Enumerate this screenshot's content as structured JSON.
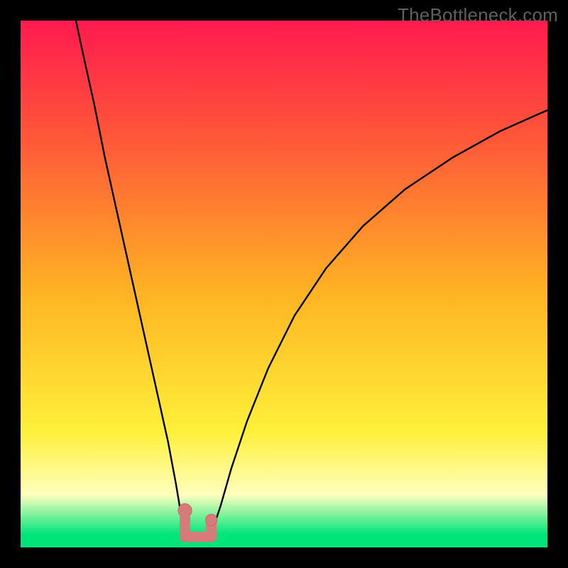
{
  "watermark": "TheBottleneck.com",
  "colors": {
    "frame": "#000000",
    "gradient_top": "#ff1a4f",
    "gradient_upper": "#ff5639",
    "gradient_mid": "#ffb423",
    "gradient_lower": "#fff03a",
    "gradient_pale": "#ffffbe",
    "gradient_bottom": "#00e57a",
    "curve": "#000000",
    "marker_fill": "#d77a7a",
    "marker_stroke": "#c96868"
  },
  "chart_data": {
    "type": "line",
    "title": "",
    "xlabel": "",
    "ylabel": "",
    "x_range": [
      0,
      100
    ],
    "y_range": [
      0,
      100
    ],
    "curve": {
      "name": "bottleneck-curve",
      "min_x": 32.5,
      "points": [
        {
          "x": 10.5,
          "y": 100
        },
        {
          "x": 12,
          "y": 93
        },
        {
          "x": 14,
          "y": 84
        },
        {
          "x": 16,
          "y": 74
        },
        {
          "x": 18,
          "y": 65
        },
        {
          "x": 20,
          "y": 56
        },
        {
          "x": 22,
          "y": 47
        },
        {
          "x": 24,
          "y": 38
        },
        {
          "x": 26,
          "y": 29
        },
        {
          "x": 28,
          "y": 20
        },
        {
          "x": 29.5,
          "y": 12
        },
        {
          "x": 30.5,
          "y": 6
        },
        {
          "x": 31.5,
          "y": 2.2
        },
        {
          "x": 32.5,
          "y": 1.6
        },
        {
          "x": 33.5,
          "y": 1.6
        },
        {
          "x": 35,
          "y": 1.8
        },
        {
          "x": 36.5,
          "y": 3.5
        },
        {
          "x": 38,
          "y": 8
        },
        {
          "x": 40,
          "y": 15
        },
        {
          "x": 43,
          "y": 24
        },
        {
          "x": 47,
          "y": 34
        },
        {
          "x": 52,
          "y": 44
        },
        {
          "x": 58,
          "y": 53
        },
        {
          "x": 65,
          "y": 61
        },
        {
          "x": 73,
          "y": 68
        },
        {
          "x": 82,
          "y": 74
        },
        {
          "x": 91,
          "y": 79
        },
        {
          "x": 100,
          "y": 83
        }
      ]
    },
    "marker": {
      "name": "optimal-region",
      "segments": [
        {
          "type": "dot",
          "x": 31.2,
          "y": 7.0,
          "r": 1.3
        },
        {
          "type": "bar",
          "x": 31.2,
          "y0": 7.0,
          "y1": 2.2,
          "w": 2.0
        },
        {
          "type": "bar_h",
          "x0": 31.2,
          "x1": 36.2,
          "y": 2.0,
          "h": 2.0
        },
        {
          "type": "bar",
          "x": 36.2,
          "y0": 2.0,
          "y1": 5.2,
          "w": 2.0
        },
        {
          "type": "dot",
          "x": 36.2,
          "y": 5.2,
          "r": 1.1
        }
      ]
    },
    "gradient_stops": [
      {
        "pct": 0,
        "key": "gradient_top"
      },
      {
        "pct": 22,
        "key": "gradient_upper"
      },
      {
        "pct": 52,
        "key": "gradient_mid"
      },
      {
        "pct": 78,
        "key": "gradient_lower"
      },
      {
        "pct": 90,
        "key": "gradient_pale"
      },
      {
        "pct": 97.5,
        "key": "gradient_bottom"
      },
      {
        "pct": 100,
        "key": "gradient_bottom"
      }
    ]
  }
}
